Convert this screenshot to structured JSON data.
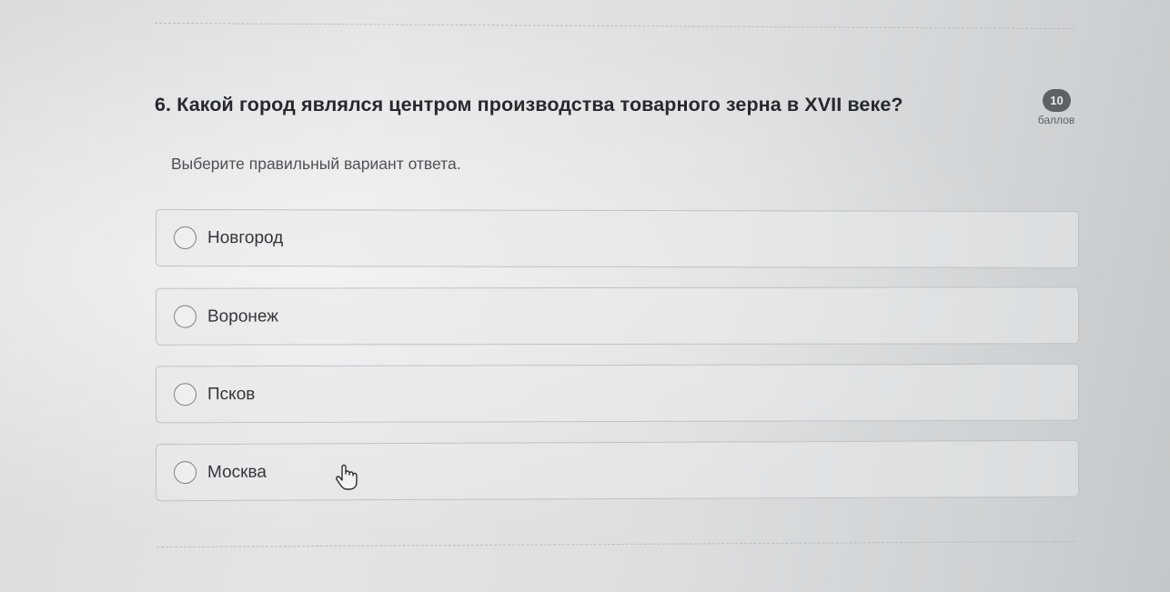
{
  "question": {
    "text": "6. Какой город являлся центром производства товарного зерна в XVII веке?",
    "points_value": "10",
    "points_label": "баллов",
    "hint": "Выберите правильный вариант ответа."
  },
  "options": [
    {
      "label": "Новгород",
      "selected": false
    },
    {
      "label": "Воронеж",
      "selected": false
    },
    {
      "label": "Псков",
      "selected": false
    },
    {
      "label": "Москва",
      "selected": false
    }
  ],
  "icons": {
    "radio": "radio-unchecked-icon",
    "cursor": "hand-pointer-icon"
  },
  "colors": {
    "background": "#dcdee0",
    "badge": "#5e6266",
    "option_border": "#bfc2c5",
    "text": "#2a2d31"
  }
}
